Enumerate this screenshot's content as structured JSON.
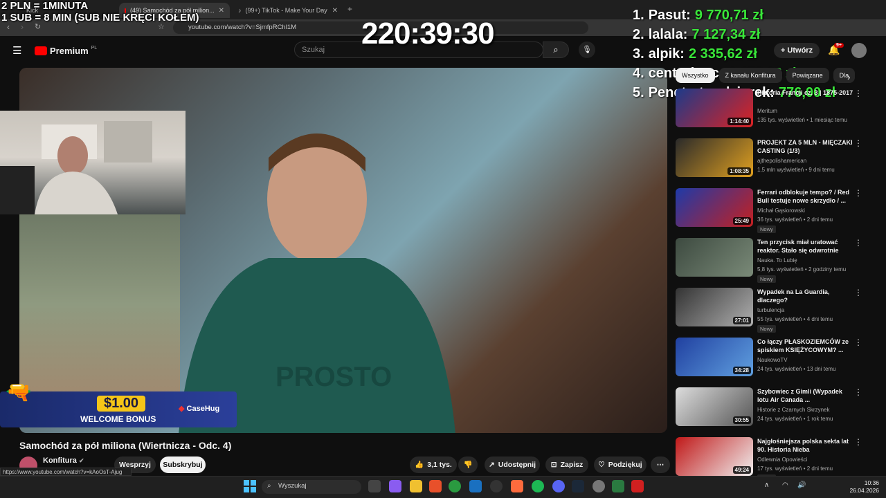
{
  "browser": {
    "tabs": [
      {
        "label": "Kick",
        "active": false
      },
      {
        "label": "(49) Samochód za pół milion...",
        "active": true
      },
      {
        "label": "(99+) TikTok - Make Your Day",
        "active": false
      }
    ],
    "url": "youtube.com/watch?v=SjmfpRChl1M"
  },
  "overlay": {
    "rule_line1": "2 PLN =  1MINUTA",
    "rule_line2": "1 SUB = 8 MIN (SUB NIE KRĘCI KOŁEM)",
    "timer": "220:39:30",
    "leaderboard": [
      {
        "rank": "1.",
        "name": "Pasut:",
        "amount": "9 770,71 zł"
      },
      {
        "rank": "2.",
        "name": "lalala:",
        "amount": "7 127,34 zł"
      },
      {
        "rank": "3.",
        "name": "alpik:",
        "amount": "2 335,62 zł"
      },
      {
        "rank": "4.",
        "name": "centurionc:",
        "amount": "1 172,08 zł"
      },
      {
        "rank": "5.",
        "name": "Penetrator dziurek:",
        "amount": "776,00 zł"
      }
    ],
    "banner": {
      "amount": "$1.00",
      "text": "WELCOME BONUS",
      "brand": "CaseHug"
    }
  },
  "youtube": {
    "logo": "Premium",
    "logo_sup": "PL",
    "search_placeholder": "Szukaj",
    "create_label": "Utwórz",
    "notif_count": "9+"
  },
  "video": {
    "title": "Samochód za pół miliona (Wiertnicza - Odc. 4)",
    "channel": "Konfitura",
    "support_label": "Wesprzyj",
    "subscribe_label": "Subskrybuj",
    "likes": "3,1 tys.",
    "share_label": "Udostępnij",
    "save_label": "Zapisz",
    "thanks_label": "Podziękuj",
    "status_url": "https://www.youtube.com/watch?v=kAoOsT-Ajug"
  },
  "sidebar": {
    "chips": [
      "Wszystko",
      "Z kanału Konfitura",
      "Powiązane",
      "Dla"
    ],
    "items": [
      {
        "title": "Historia Francji cz. 3 | 1875-2017",
        "channel": "Meritum",
        "meta": "135 tys. wyświetleń • 1 miesiąc temu",
        "badge": "",
        "duration": "1:14:40",
        "c1": "#1c3a8a",
        "c2": "#d22"
      },
      {
        "title": "PROJEKT ZA 5 MLN - MIĘCZAKI CASTING (1/3)",
        "channel": "ajthepolishamerican",
        "meta": "1,5 mln wyświetleń • 9 dni temu",
        "badge": "",
        "duration": "1:08:35",
        "c1": "#2a2a2a",
        "c2": "#e0a020"
      },
      {
        "title": "Ferrari odblokuje tempo? / Red Bull testuje nowe skrzydło / ...",
        "channel": "Michał Gąsiorowski",
        "meta": "36 tys. wyświetleń • 2 dni temu",
        "badge": "Nowy",
        "duration": "25:49",
        "c1": "#1e3aa8",
        "c2": "#c52020"
      },
      {
        "title": "Ten przycisk miał uratować reaktor. Stało się odwrotnie",
        "channel": "Nauka. To Lubię",
        "meta": "5,8 tys. wyświetleń • 2 godziny temu",
        "badge": "Nowy",
        "duration": "",
        "c1": "#3d4a40",
        "c2": "#7a8a78"
      },
      {
        "title": "Wypadek na La Guardia, dlaczego?",
        "channel": "turbulencja",
        "meta": "55 tys. wyświetleń • 4 dni temu",
        "badge": "Nowy",
        "duration": "27:01",
        "c1": "#333",
        "c2": "#b0b0b0"
      },
      {
        "title": "Co łączy PŁASKOZIEMCÓW ze spiskiem KSIĘŻYCOWYM? ...",
        "channel": "NaukowoTV",
        "meta": "24 tys. wyświetleń • 13 dni temu",
        "badge": "",
        "duration": "34:28",
        "c1": "#2040a0",
        "c2": "#60a0e0"
      },
      {
        "title": "Szybowiec z Gimli (Wypadek lotu Air Canada ...",
        "channel": "Historie z Czarnych Skrzynek",
        "meta": "24 tys. wyświetleń • 1 rok temu",
        "badge": "",
        "duration": "30:55",
        "c1": "#ddd",
        "c2": "#555"
      },
      {
        "title": "Najgłośniejsza polska sekta lat 90. Historia Nieba",
        "channel": "Odlewnia Opowieści",
        "meta": "17 tys. wyświetleń • 2 dni temu",
        "badge": "Nowy",
        "duration": "49:24",
        "c1": "#c01818",
        "c2": "#f0f0f0"
      }
    ]
  },
  "taskbar": {
    "search": "Wyszukaj",
    "time": "10:36",
    "date": "26.04.2026"
  }
}
